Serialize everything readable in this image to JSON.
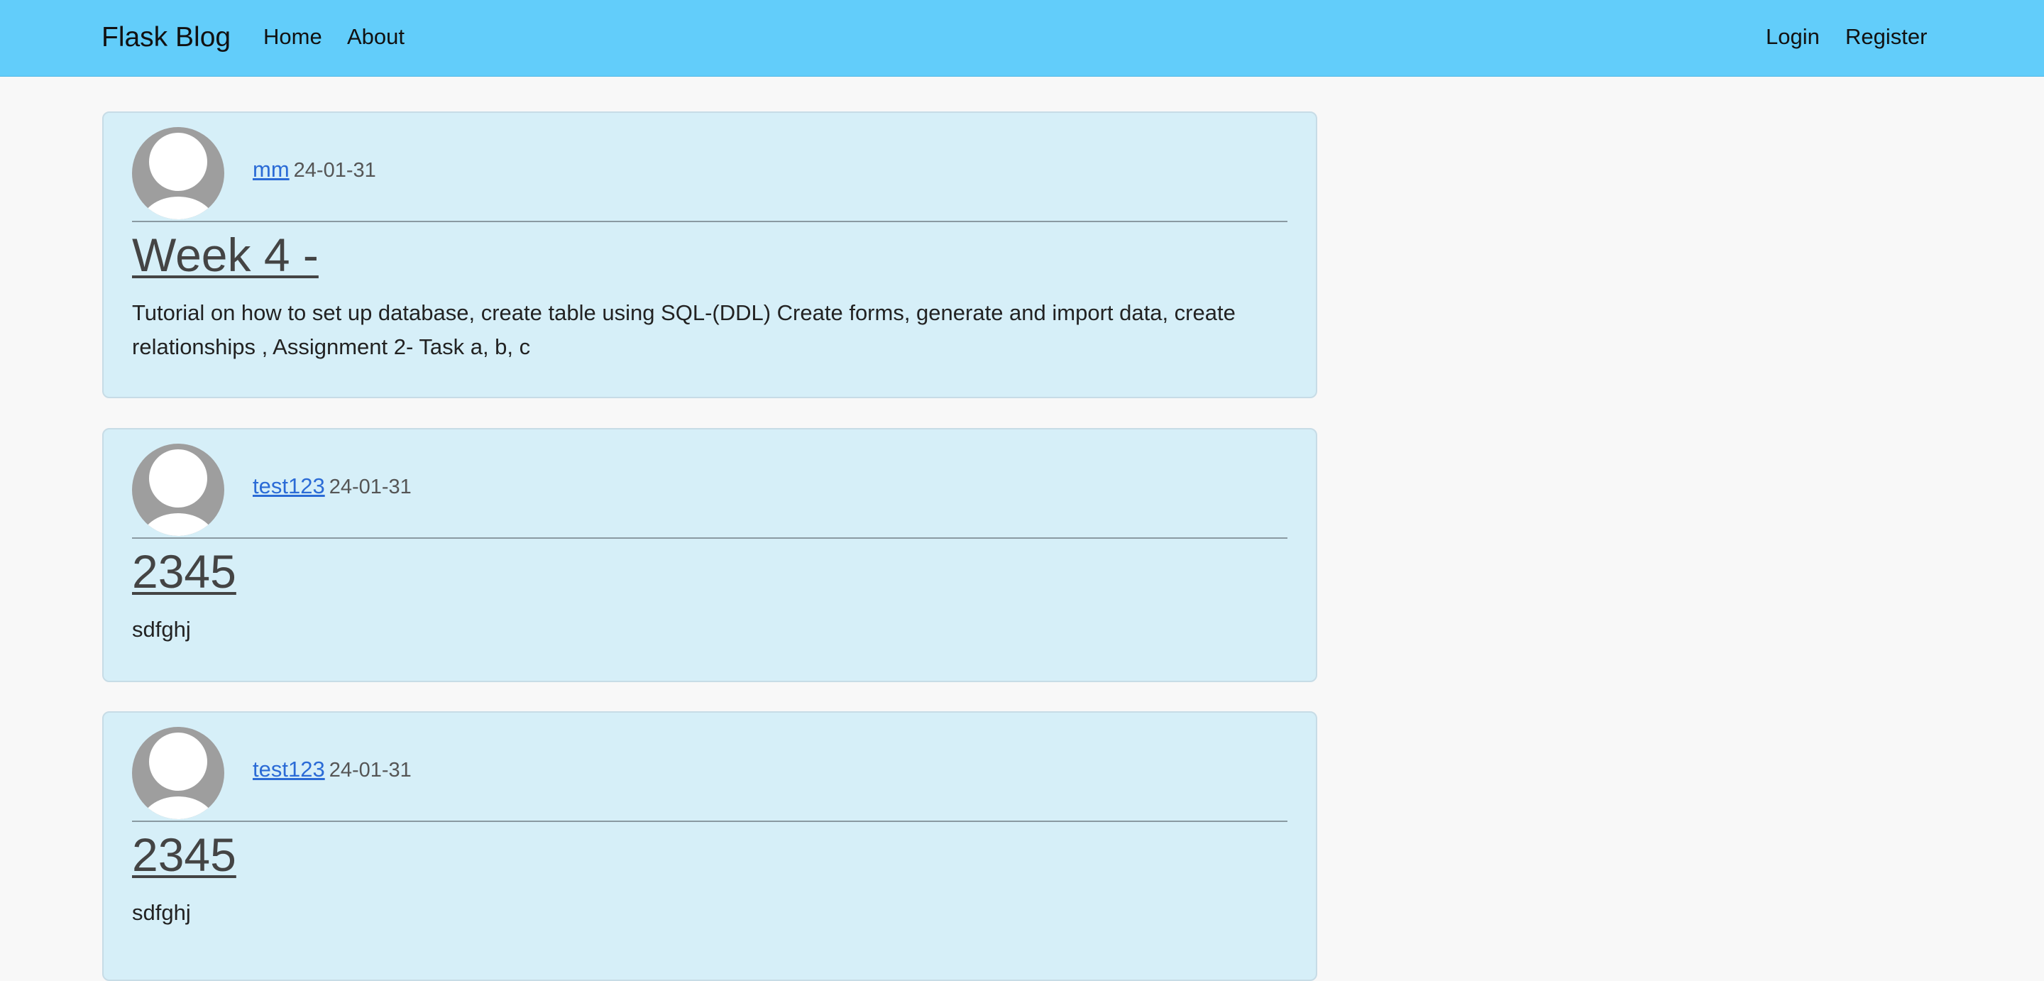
{
  "navbar": {
    "brand": "Flask Blog",
    "links": [
      "Home",
      "About"
    ],
    "auth_links": [
      "Login",
      "Register"
    ]
  },
  "posts": [
    {
      "author": "mm",
      "date": "24-01-31",
      "title": "Week 4 -",
      "content": "Tutorial on how to set up database, create table using SQL-(DDL) Create forms, generate and import data, create relationships , Assignment 2- Task a, b, c"
    },
    {
      "author": "test123",
      "date": "24-01-31",
      "title": "2345",
      "content": "sdfghj"
    },
    {
      "author": "test123",
      "date": "24-01-31",
      "title": "2345",
      "content": "sdfghj"
    }
  ],
  "icons": {
    "avatar": "user-avatar-icon"
  },
  "colors": {
    "navbar": "#62cdfa",
    "post_background": "#d6eff8",
    "author_link": "#2b6bd6",
    "page_background": "#f8f8f8"
  }
}
